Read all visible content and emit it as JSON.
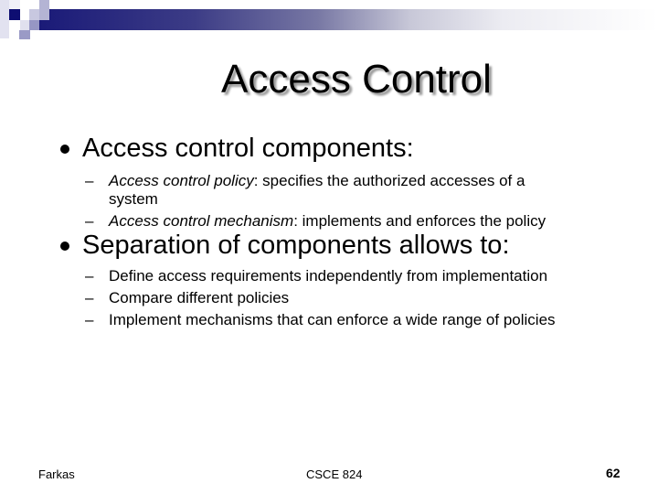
{
  "slide": {
    "title": "Access Control",
    "colors": {
      "accent": "#1a1a78",
      "text": "#000000"
    },
    "bullets": [
      {
        "text": "Access control components:",
        "subitems": [
          {
            "term": "Access control policy",
            "rest": ": specifies the authorized accesses of a",
            "cont": "system"
          },
          {
            "term": "Access control mechanism",
            "rest": ": implements and enforces the policy"
          }
        ]
      },
      {
        "text": "Separation of components allows to:",
        "subitems": [
          {
            "text": "Define access requirements independently from implementation"
          },
          {
            "text": "Compare different policies"
          },
          {
            "text": "Implement mechanisms that can enforce a wide range of policies"
          }
        ]
      }
    ],
    "footer": {
      "author": "Farkas",
      "course": "CSCE 824",
      "page": "62"
    },
    "dash_glyph": "–"
  }
}
